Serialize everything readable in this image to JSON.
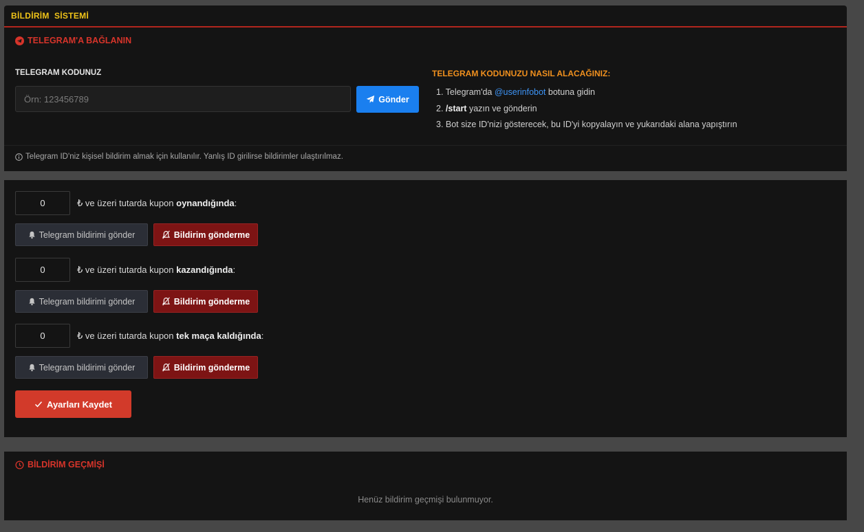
{
  "header": {
    "title": "BİLDİRİM  SİSTEMİ"
  },
  "telegram": {
    "section_title": "TELEGRAM'A BAĞLANIN",
    "code_label": "TELEGRAM KODUNUZ",
    "code_placeholder": "Örn: 123456789",
    "code_value": "",
    "send_label": "Gönder",
    "how_title": "TELEGRAM KODUNUZU NASIL ALACAĞINIZ:",
    "steps": {
      "s1_prefix": "1. Telegram'da ",
      "s1_link": "@userinfobot",
      "s1_suffix": " botuna gidin",
      "s2_num": "2. ",
      "s2_cmd": "/start",
      "s2_suffix": " yazın ve gönderin",
      "s3": "3. Bot size ID'nizi gösterecek, bu ID'yi kopyalayın ve yukarıdaki alana yapıştırın"
    },
    "note": "Telegram ID'niz kişisel bildirim almak için kullanılır. Yanlış ID girilirse bildirimler ulaştırılmaz."
  },
  "rules": [
    {
      "amount": "0",
      "prefix": "₺ ve üzeri tutarda kupon ",
      "event": "oynandığında",
      "suffix": ":",
      "tg_label": "Telegram bildirimi gönder",
      "no_label": "Bildirim gönderme"
    },
    {
      "amount": "0",
      "prefix": "₺ ve üzeri tutarda kupon ",
      "event": "kazandığında",
      "suffix": ":",
      "tg_label": "Telegram bildirimi gönder",
      "no_label": "Bildirim gönderme"
    },
    {
      "amount": "0",
      "prefix": "₺ ve üzeri tutarda kupon ",
      "event": "tek maça kaldığında",
      "suffix": ":",
      "tg_label": "Telegram bildirimi gönder",
      "no_label": "Bildirim gönderme"
    }
  ],
  "save_label": "Ayarları Kaydet",
  "history": {
    "title": "BİLDİRİM GEÇMİŞİ",
    "empty": "Henüz bildirim geçmişi bulunmuyor."
  },
  "colors": {
    "accent_yellow": "#f0c419",
    "accent_red": "#d6342a",
    "accent_orange": "#f0901e",
    "primary_blue": "#1a7fef",
    "danger_dark": "#7d1414"
  },
  "icons": {
    "telegram": "telegram-icon",
    "send": "paper-plane-icon",
    "info": "info-circle-icon",
    "bell": "bell-icon",
    "bell_off": "bell-slash-icon",
    "check": "check-icon",
    "clock": "clock-icon"
  }
}
